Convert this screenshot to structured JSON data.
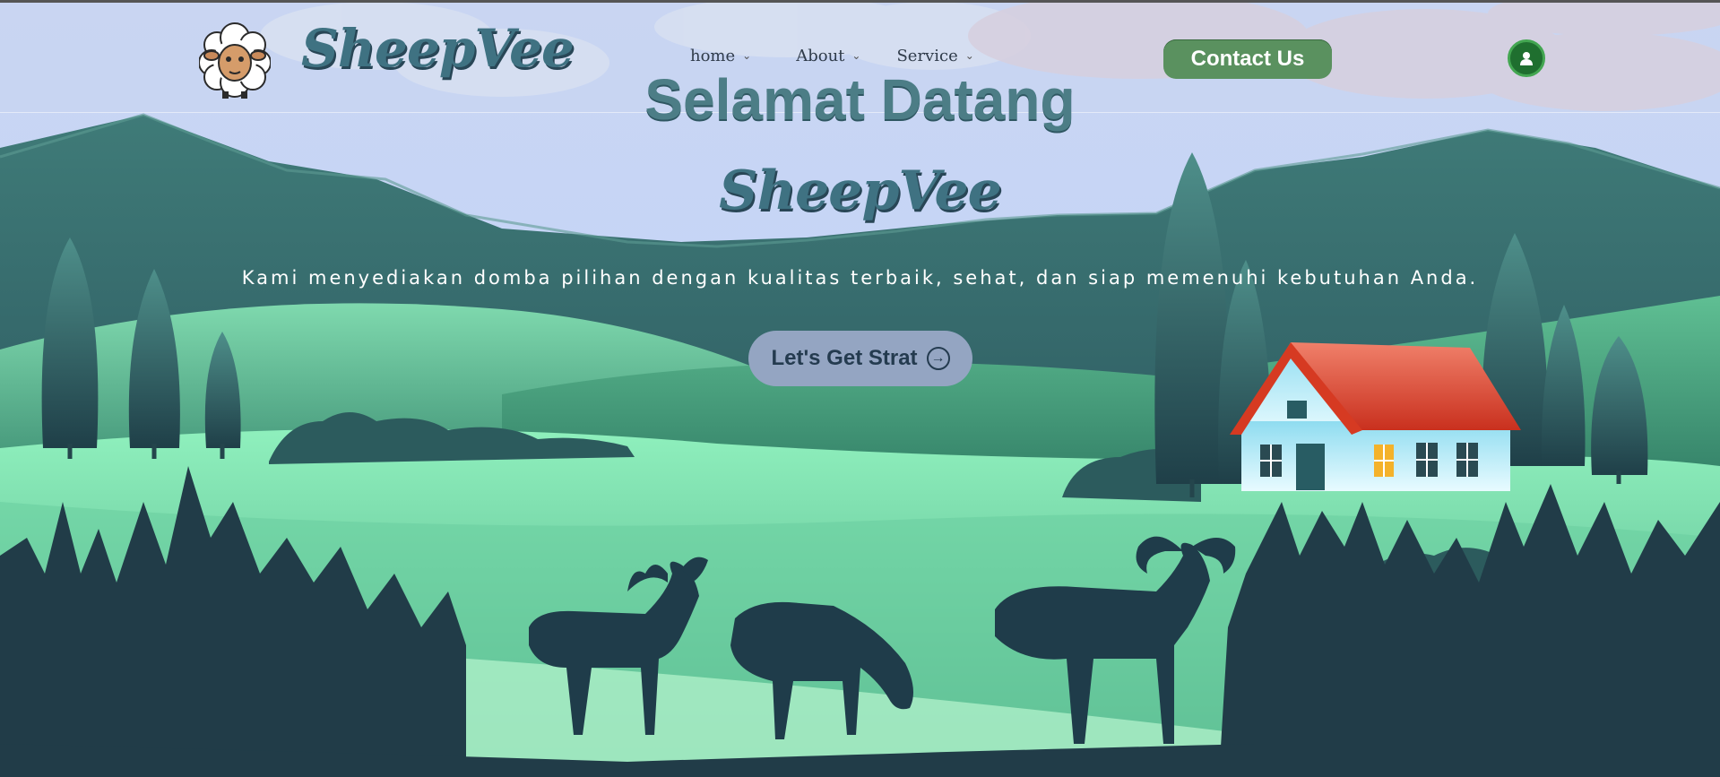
{
  "header": {
    "brand_name": "SheepVee",
    "nav": [
      {
        "label": "home",
        "icon": "chevron-down-icon"
      },
      {
        "label": "About",
        "icon": "chevron-down-icon"
      },
      {
        "label": "Service",
        "icon": "chevron-down-icon"
      }
    ],
    "contact_label": "Contact Us",
    "user_icon": "user-icon"
  },
  "hero": {
    "title": "Selamat Datang",
    "brand_name": "SheepVee",
    "subtitle": "Kami menyediakan domba pilihan dengan kualitas terbaik, sehat, dan siap memenuhi kebutuhan Anda.",
    "cta_label": "Let's Get Strat",
    "cta_icon": "arrow-right-circle-icon"
  },
  "colors": {
    "sky": "#c3d3f7",
    "accent_green": "#5a915f",
    "title_teal": "#4c7d86",
    "cta_bg": "#94a5c2",
    "roof_red": "#e24a2c"
  }
}
